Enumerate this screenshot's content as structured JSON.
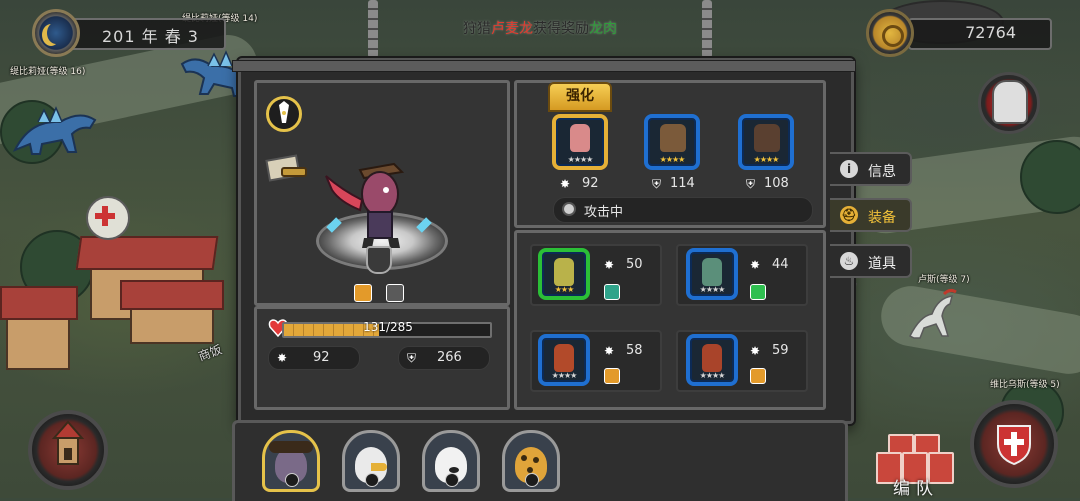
{
  "hud": {
    "season": "201 年 春 3",
    "gold": "72764",
    "notice_prefix": "狩猎",
    "notice_target": "卢麦龙",
    "notice_middle": "获得奖励",
    "notice_reward": "龙肉"
  },
  "map_labels": {
    "top_left": "缇比莉娅(等级 16)",
    "top_center": "缇比莉娅(等级 14)",
    "right_mid": "卢斯(等级 7)",
    "bottom_right": "维比乌斯(等级 5)",
    "building_sign": "商饭"
  },
  "hero": {
    "hp_current": 131,
    "hp_max": 285,
    "hp_text": "131/285",
    "attack": "92",
    "defense": "266"
  },
  "equipped": {
    "strengthen_label": "强化",
    "slots": [
      {
        "value": "92",
        "rarity": "gold",
        "stars": "silver"
      },
      {
        "value": "114",
        "rarity": "blue",
        "stars": "gold"
      },
      {
        "value": "108",
        "rarity": "blue",
        "stars": "gold"
      }
    ],
    "status": "攻击中"
  },
  "inventory": [
    {
      "value": "50",
      "rarity": "green",
      "stars": "gold"
    },
    {
      "value": "44",
      "rarity": "blue",
      "stars": "silver"
    },
    {
      "value": "58",
      "rarity": "blue",
      "stars": "silver"
    },
    {
      "value": "59",
      "rarity": "blue",
      "stars": "silver"
    }
  ],
  "side_tabs": [
    {
      "label": "信息",
      "icon": "info-icon",
      "active": false
    },
    {
      "label": "装备",
      "icon": "equipment-icon",
      "active": true
    },
    {
      "label": "道具",
      "icon": "potion-icon",
      "active": false
    }
  ],
  "bottom": {
    "team_label": "编队",
    "heroes": [
      "rat-pirate",
      "eagle",
      "polar-bear",
      "leopard"
    ]
  },
  "colors": {
    "gold_accent": "#e5b037",
    "blue_frame": "#1f6fd1",
    "green_frame": "#2bbf37",
    "hp_fill": "#e3a83a",
    "notice_red": "#e33b2e",
    "notice_green": "#2e9f3a"
  }
}
